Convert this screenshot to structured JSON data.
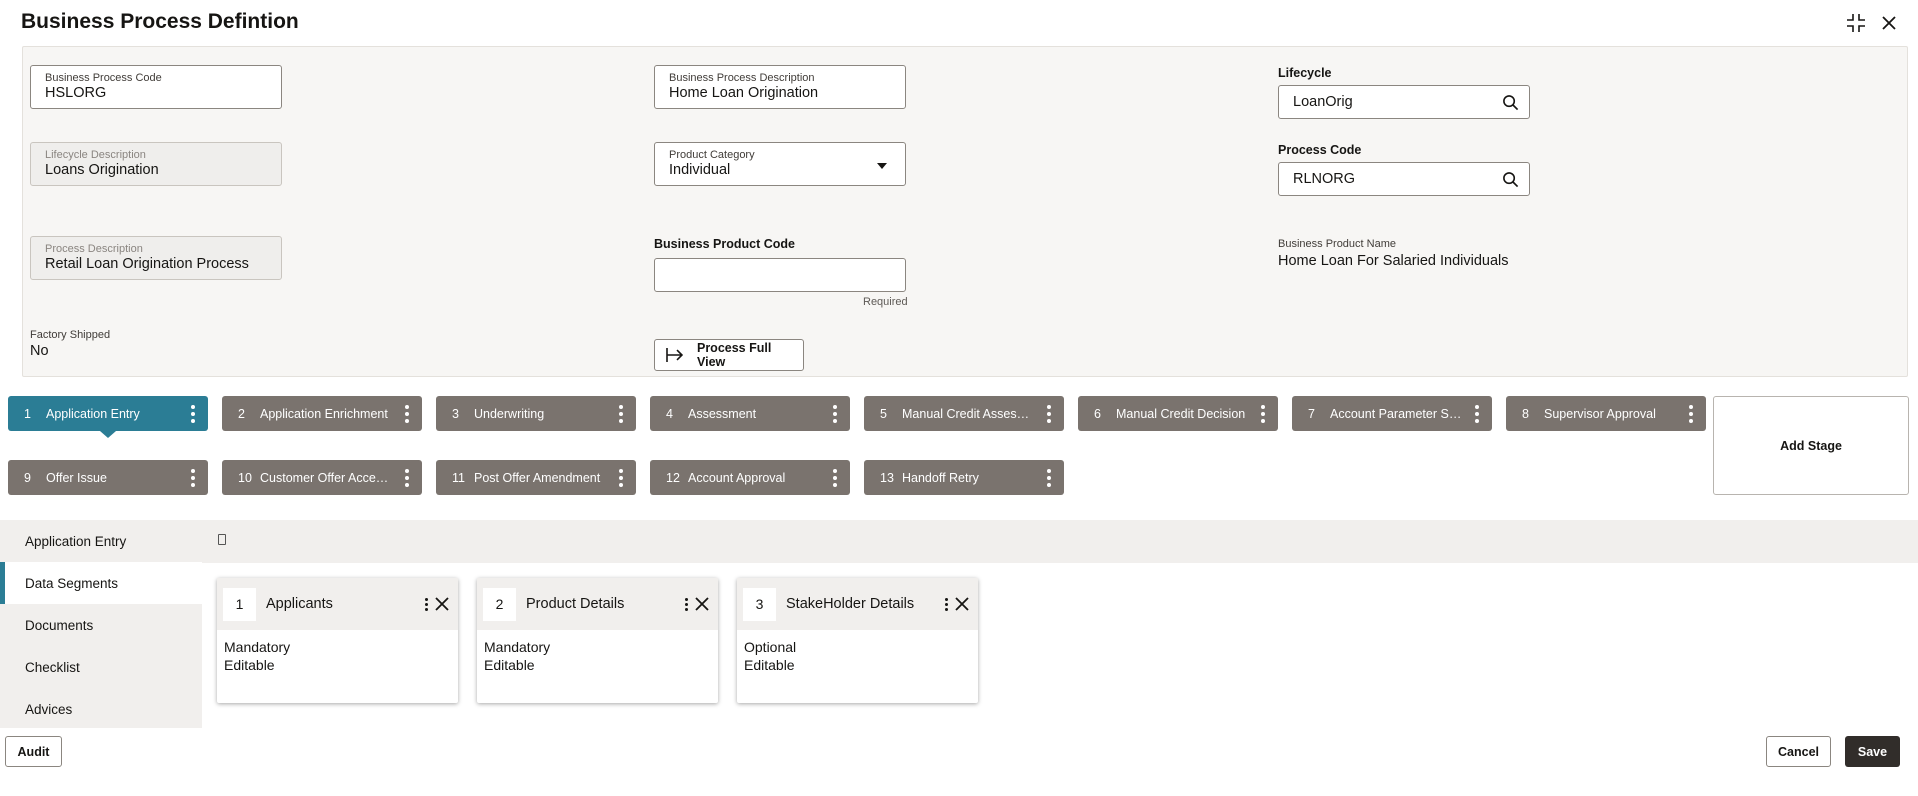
{
  "header": {
    "title": "Business Process Defintion"
  },
  "form": {
    "business_process_code": {
      "label": "Business Process Code",
      "value": "HSLORG"
    },
    "business_process_description": {
      "label": "Business Process Description",
      "value": "Home Loan Origination"
    },
    "lifecycle": {
      "label": "Lifecycle",
      "value": "LoanOrig"
    },
    "lifecycle_description": {
      "label": "Lifecycle Description",
      "value": "Loans Origination"
    },
    "product_category": {
      "label": "Product Category",
      "value": "Individual"
    },
    "process_code": {
      "label": "Process Code",
      "value": "RLNORG"
    },
    "process_description": {
      "label": "Process Description",
      "value": "Retail Loan Origination Process"
    },
    "business_product_code": {
      "label": "Business Product Code",
      "value": "",
      "hint": "Required"
    },
    "business_product_name": {
      "label": "Business Product Name",
      "value": "Home Loan For Salaried Individuals"
    },
    "factory_shipped": {
      "label": "Factory Shipped",
      "value": "No"
    },
    "process_full_view_label": "Process Full View"
  },
  "stages": [
    {
      "num": "1",
      "label": "Application Entry"
    },
    {
      "num": "2",
      "label": "Application Enrichment"
    },
    {
      "num": "3",
      "label": "Underwriting"
    },
    {
      "num": "4",
      "label": "Assessment"
    },
    {
      "num": "5",
      "label": "Manual Credit Assessment"
    },
    {
      "num": "6",
      "label": "Manual Credit Decision"
    },
    {
      "num": "7",
      "label": "Account Parameter Setup"
    },
    {
      "num": "8",
      "label": "Supervisor Approval"
    },
    {
      "num": "9",
      "label": "Offer Issue"
    },
    {
      "num": "10",
      "label": "Customer Offer Acceptance"
    },
    {
      "num": "11",
      "label": "Post Offer Amendment"
    },
    {
      "num": "12",
      "label": "Account Approval"
    },
    {
      "num": "13",
      "label": "Handoff Retry"
    }
  ],
  "add_stage_label": "Add Stage",
  "left_nav": {
    "items": [
      {
        "label": "Application Entry"
      },
      {
        "label": "Data Segments"
      },
      {
        "label": "Documents"
      },
      {
        "label": "Checklist"
      },
      {
        "label": "Advices"
      }
    ]
  },
  "segments": [
    {
      "num": "1",
      "name": "Applicants",
      "line1": "Mandatory",
      "line2": "Editable"
    },
    {
      "num": "2",
      "name": "Product Details",
      "line1": "Mandatory",
      "line2": "Editable"
    },
    {
      "num": "3",
      "name": "StakeHolder Details",
      "line1": "Optional",
      "line2": "Editable"
    }
  ],
  "footer": {
    "audit_label": "Audit",
    "cancel_label": "Cancel",
    "save_label": "Save"
  }
}
